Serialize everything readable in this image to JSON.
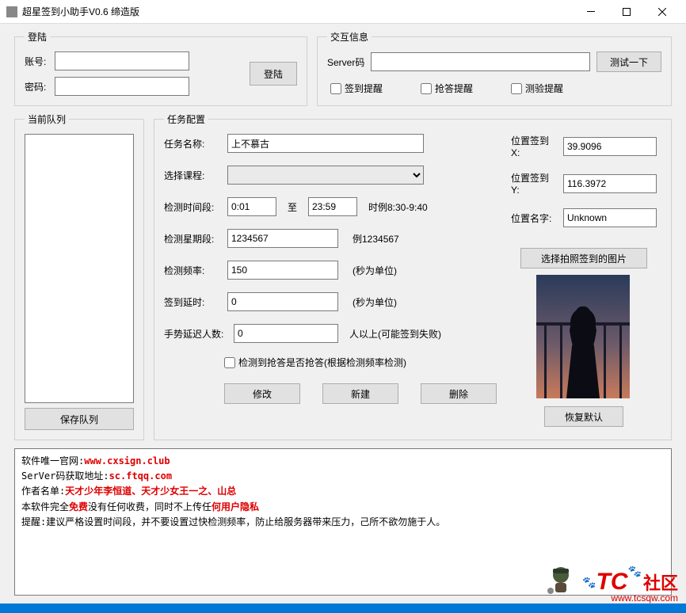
{
  "title": "超星签到小助手V0.6 缔造版",
  "login": {
    "legend": "登陆",
    "account_label": "账号:",
    "password_label": "密码:",
    "account_value": "",
    "password_value": "",
    "login_btn": "登陆"
  },
  "interact": {
    "legend": "交互信息",
    "server_label": "Server码",
    "server_value": "",
    "test_btn": "测试一下",
    "chk_signin": "签到提醒",
    "chk_rush": "抢答提醒",
    "chk_test": "测验提醒"
  },
  "queue": {
    "legend": "当前队列",
    "save_btn": "保存队列"
  },
  "task": {
    "legend": "任务配置",
    "name_label": "任务名称:",
    "name_value": "上不慕古",
    "course_label": "选择课程:",
    "course_value": "",
    "time_label": "检测时间段:",
    "time_from": "0:01",
    "time_sep": "至",
    "time_to": "23:59",
    "time_hint": "时例8:30-9:40",
    "week_label": "检测星期段:",
    "week_value": "1234567",
    "week_hint": "例1234567",
    "freq_label": "检测频率:",
    "freq_value": "150",
    "freq_hint": "(秒为单位)",
    "delay_label": "签到延时:",
    "delay_value": "0",
    "delay_hint": "(秒为单位)",
    "gesture_label": "手势延迟人数:",
    "gesture_value": "0",
    "gesture_hint": "人以上(可能签到失败)",
    "auto_answer": "检测到抢答是否抢答(根据检测频率检测)",
    "modify_btn": "修改",
    "new_btn": "新建",
    "delete_btn": "删除"
  },
  "location": {
    "x_label": "位置签到X:",
    "x_value": "39.9096",
    "y_label": "位置签到Y:",
    "y_value": "116.3972",
    "name_label": "位置名字:",
    "name_value": "Unknown",
    "photo_btn": "选择拍照签到的图片",
    "restore_btn": "恢复默认"
  },
  "info": {
    "l1a": "软件唯一官网:",
    "l1b": "www.cxsign.club",
    "l2a": "SerVer码获取地址:",
    "l2b": "sc.ftqq.com",
    "l3a": "作者名单:",
    "l3b": "天才少年李恒道、天才少女王一之、山总",
    "l4a": "本软件完全",
    "l4b": "免费",
    "l4c": "没有任何收费，同时不上传任",
    "l4d": "何用户隐私",
    "l5": "提醒:建议严格设置时间段，并不要设置过快检测频率，防止给服务器带来压力，己所不欲勿施于人。"
  },
  "watermark": {
    "tc": "TC",
    "cn": "社区",
    "url": "www.tcsqw.com"
  }
}
